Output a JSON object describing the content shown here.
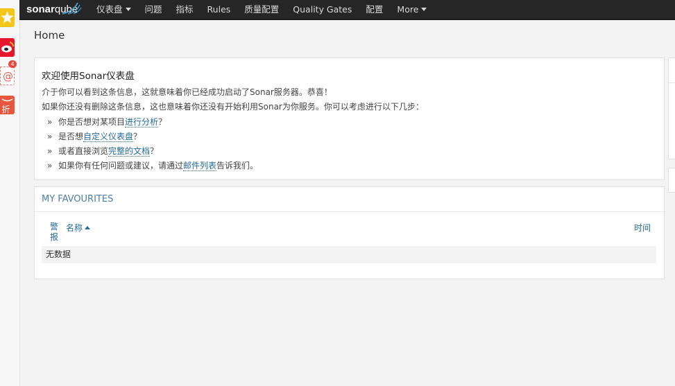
{
  "nav": {
    "logo_bold": "sonar",
    "logo_rest": "qube",
    "items": [
      {
        "label": "仪表盘",
        "dropdown": true
      },
      {
        "label": "问题",
        "dropdown": false
      },
      {
        "label": "指标",
        "dropdown": false
      },
      {
        "label": "Rules",
        "dropdown": false
      },
      {
        "label": "质量配置",
        "dropdown": false
      },
      {
        "label": "Quality Gates",
        "dropdown": false
      },
      {
        "label": "配置",
        "dropdown": false
      },
      {
        "label": "More",
        "dropdown": true
      }
    ]
  },
  "dock": {
    "badge": "4",
    "icons": [
      "favorites-star-icon",
      "weibo-icon",
      "mail-icon",
      "discount-icon"
    ],
    "discount_char": "折"
  },
  "page": {
    "title": "Home"
  },
  "welcome": {
    "heading": "欢迎使用Sonar仪表盘",
    "line1": "介于你可以看到这条信息，这就意味着你已经成功启动了Sonar服务器。恭喜！",
    "line2": "如果你还没有删除这条信息，这也意味着你还没有开始利用Sonar为你服务。你可以考虑进行以下几步：",
    "bullet": "»",
    "steps": [
      {
        "pre": "你是否想对某项目",
        "link": "进行分析",
        "post": "？"
      },
      {
        "pre": "是否想",
        "link": "自定义仪表盘",
        "post": "？"
      },
      {
        "pre": "或者直接浏览",
        "link": "完整的文档",
        "post": "？"
      },
      {
        "pre": "如果你有任何问题或建议，请通过",
        "link": "邮件列表",
        "post": "告诉我们。"
      }
    ]
  },
  "favourites": {
    "title": "MY FAVOURITES",
    "columns": {
      "alert": "警报",
      "name": "名称",
      "time": "时间"
    },
    "empty": "无数据"
  },
  "colors": {
    "navbar": "#262626",
    "link": "#236a97",
    "section_title": "#4b7ea8",
    "background": "#f3f3f3"
  }
}
